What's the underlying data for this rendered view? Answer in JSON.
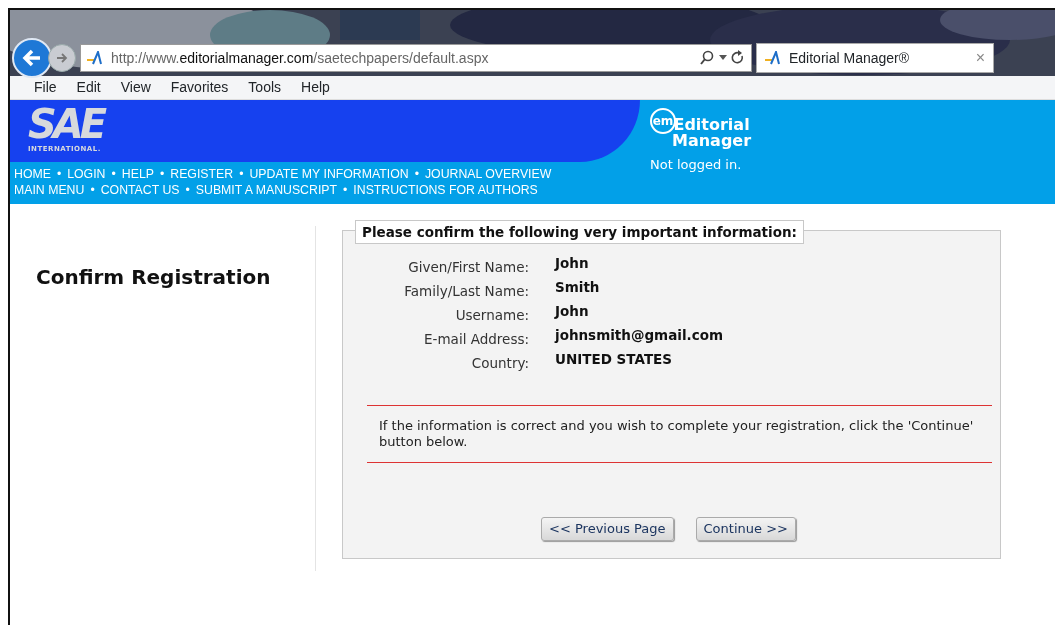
{
  "browser": {
    "address": {
      "prefix": "http://www.",
      "domain": "editorialmanager.com",
      "path": "/saetechpapers/default.aspx"
    },
    "tab": {
      "title": "Editorial Manager®",
      "close": "×",
      "selected": true
    },
    "menu": [
      "File",
      "Edit",
      "View",
      "Favorites",
      "Tools",
      "Help"
    ]
  },
  "header": {
    "logo": {
      "letters": "SAE",
      "subtitle": "INTERNATIONAL."
    },
    "em_logo": {
      "badge": "em",
      "line1": "Editorial",
      "line2": "Manager"
    },
    "login_status": "Not logged in.",
    "separator": "•",
    "nav_rows": [
      [
        "HOME",
        "LOGIN",
        "HELP",
        "REGISTER",
        "UPDATE MY INFORMATION",
        "JOURNAL OVERVIEW"
      ],
      [
        "MAIN MENU",
        "CONTACT US",
        "SUBMIT A MANUSCRIPT",
        "INSTRUCTIONS FOR AUTHORS"
      ]
    ]
  },
  "page_title": "Confirm Registration",
  "panel": {
    "legend": "Please confirm the following very important information:",
    "fields": [
      {
        "label": "Given/First Name:",
        "value": "John"
      },
      {
        "label": "Family/Last Name:",
        "value": "Smith"
      },
      {
        "label": "Username:",
        "value": "John"
      },
      {
        "label": "E-mail Address:",
        "value": "johnsmith@gmail.com"
      },
      {
        "label": "Country:",
        "value": "UNITED STATES"
      }
    ],
    "message": "If the information is correct and you wish to complete your registration, click the 'Continue' button below.",
    "buttons": [
      "<< Previous Page",
      "Continue >>"
    ]
  }
}
